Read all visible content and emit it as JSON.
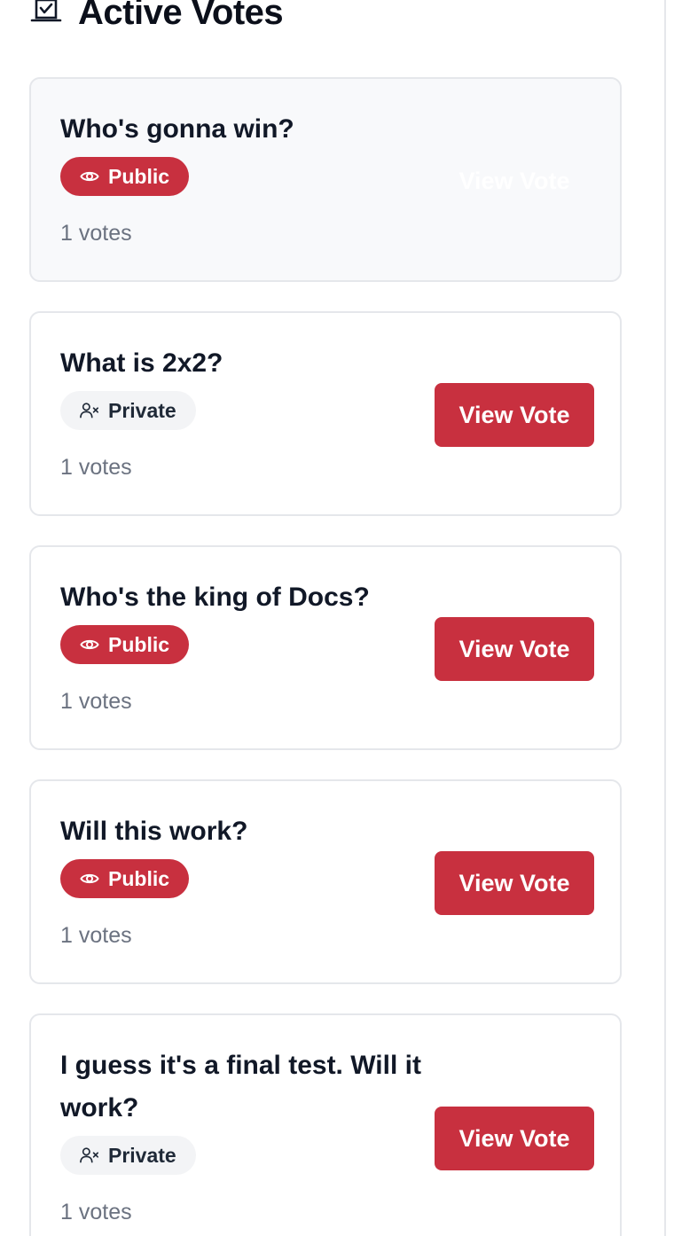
{
  "header": {
    "title": "Active Votes",
    "icon": "vote-box-icon"
  },
  "colors": {
    "accent": "#c8303f",
    "private_badge_bg": "#f3f4f6",
    "border": "#e5e7eb",
    "muted_text": "#6b7280"
  },
  "votes": [
    {
      "title": "Who's gonna win?",
      "visibility": "Public",
      "visibility_icon": "eye-icon",
      "count": "1 votes",
      "button": "View Vote"
    },
    {
      "title": "What is 2x2?",
      "visibility": "Private",
      "visibility_icon": "user-x-icon",
      "count": "1 votes",
      "button": "View Vote"
    },
    {
      "title": "Who's the king of Docs?",
      "visibility": "Public",
      "visibility_icon": "eye-icon",
      "count": "1 votes",
      "button": "View Vote"
    },
    {
      "title": "Will this work?",
      "visibility": "Public",
      "visibility_icon": "eye-icon",
      "count": "1 votes",
      "button": "View Vote"
    },
    {
      "title": "I guess it's a final test. Will it work?",
      "visibility": "Private",
      "visibility_icon": "user-x-icon",
      "count": "1 votes",
      "button": "View Vote"
    }
  ]
}
